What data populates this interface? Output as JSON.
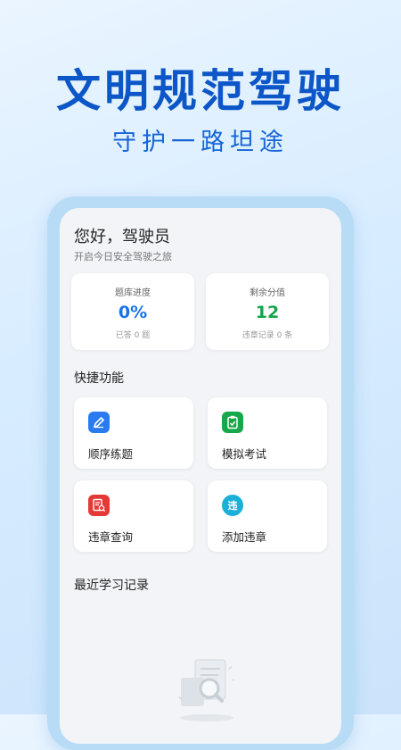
{
  "hero": {
    "title": "文明规范驾驶",
    "subtitle": "守护一路坦途"
  },
  "greeting": {
    "title": "您好，驾驶员",
    "subtitle": "开启今日安全驾驶之旅"
  },
  "stats": [
    {
      "label": "题库进度",
      "value": "0%",
      "note": "已答 0 题",
      "color": "#1a73e8"
    },
    {
      "label": "剩余分值",
      "value": "12",
      "note": "违章记录 0 条",
      "color": "#16a34a"
    }
  ],
  "quick": {
    "title": "快捷功能",
    "items": [
      {
        "label": "顺序练题",
        "icon": "edit-icon"
      },
      {
        "label": "模拟考试",
        "icon": "clipboard-check-icon"
      },
      {
        "label": "违章查询",
        "icon": "document-search-icon"
      },
      {
        "label": "添加违章",
        "icon": "violation-badge-icon",
        "glyph": "违"
      }
    ]
  },
  "recent": {
    "title": "最近学习记录"
  }
}
